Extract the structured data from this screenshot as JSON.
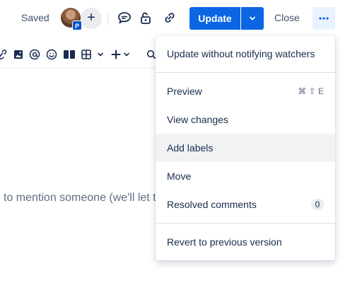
{
  "header": {
    "saved_label": "Saved",
    "avatar_badge": "P",
    "update_label": "Update",
    "close_label": "Close"
  },
  "editor": {
    "body_text": "to mention someone (we'll let t"
  },
  "menu": {
    "items": [
      {
        "label": "Update without notifying watchers"
      },
      {
        "label": "Preview",
        "shortcut": "⌘ ⇧ E"
      },
      {
        "label": "View changes"
      },
      {
        "label": "Add labels"
      },
      {
        "label": "Move"
      },
      {
        "label": "Resolved comments",
        "count": "0"
      },
      {
        "label": "Revert to previous version"
      }
    ]
  },
  "colors": {
    "primary": "#0c66e4",
    "hover_bg": "#f1f2f4",
    "more_bg": "#e9f2ff"
  }
}
